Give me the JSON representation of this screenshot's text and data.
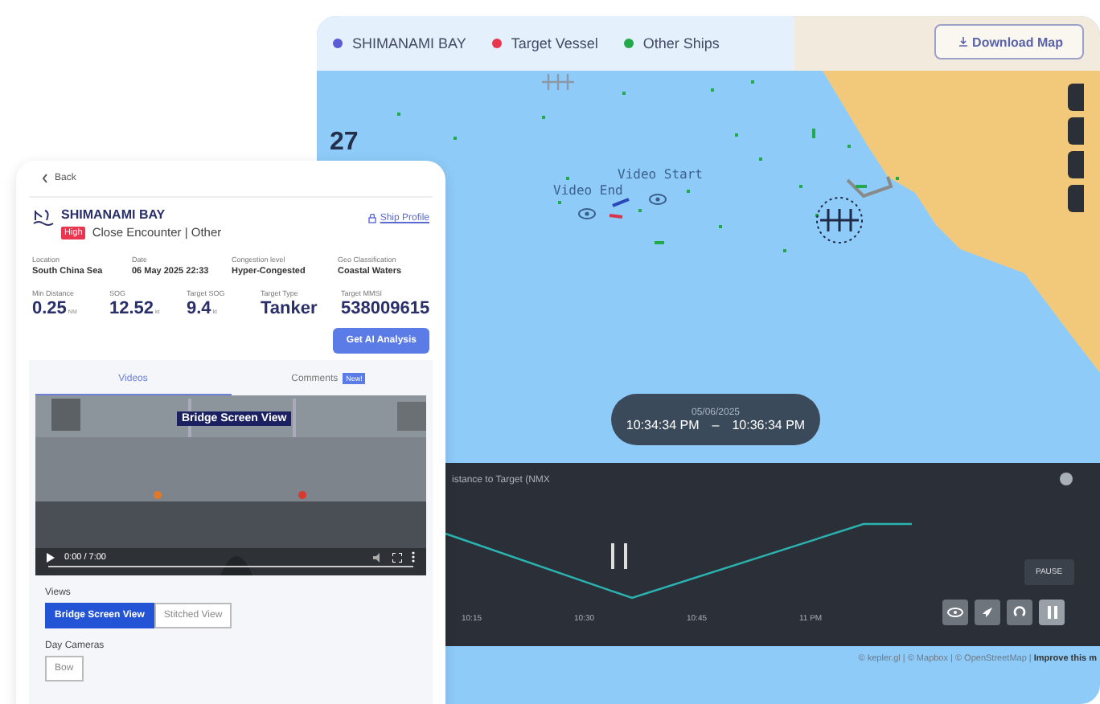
{
  "map": {
    "legend": [
      {
        "label": "SHIMANAMI BAY",
        "color": "#5b5bd6"
      },
      {
        "label": "Target Vessel",
        "color": "#e8364f"
      },
      {
        "label": "Other Ships",
        "color": "#22a94b"
      }
    ],
    "download_button": "Download Map",
    "grid_label": "27",
    "markers": [
      {
        "label": "Video Start"
      },
      {
        "label": "Video End"
      }
    ],
    "time_window": {
      "date": "05/06/2025",
      "start": "10:34:34 PM",
      "separator": "–",
      "end": "10:36:34 PM"
    },
    "timeline": {
      "title": "istance to Target (NMX",
      "xticks": [
        "10:15",
        "10:30",
        "10:45",
        "11 PM"
      ],
      "tooltip": "PAUSE",
      "controls": [
        {
          "kind": "eye",
          "selected": false
        },
        {
          "kind": "rocket",
          "selected": false
        },
        {
          "kind": "replay",
          "selected": false
        },
        {
          "kind": "pause",
          "selected": true
        }
      ]
    },
    "attribution": "© kepler.gl | © Mapbox | © OpenStreetMap | **Improve this m**"
  },
  "panel": {
    "back": "Back",
    "vessel": "SHIMANAMI BAY",
    "severity": "High",
    "event": "Close Encounter | Other",
    "profile_link": "Ship Profile",
    "info": [
      {
        "label": "Location",
        "value": "South China Sea"
      },
      {
        "label": "Date",
        "value": "06 May 2025 22:33"
      },
      {
        "label": "Congestion level",
        "value": "Hyper-Congested"
      },
      {
        "label": "Geo Classification",
        "value": "Coastal Waters"
      }
    ],
    "stats": [
      {
        "label": "Min Distance",
        "value": "0.25",
        "unit": "NM"
      },
      {
        "label": "SOG",
        "value": "12.52",
        "unit": "kt"
      },
      {
        "label": "Target SOG",
        "value": "9.4",
        "unit": "kt"
      },
      {
        "label": "Target Type",
        "value": "Tanker"
      },
      {
        "label": "Target MMSI",
        "value": "538009615"
      }
    ],
    "ai_button": "Get AI Analysis",
    "tabs": [
      {
        "label": "Videos",
        "selected": true
      },
      {
        "label": "Comments",
        "badge": "New!",
        "selected": false
      }
    ],
    "video": {
      "overlay_label": "Bridge Screen View",
      "time": "0:00 / 7:00"
    },
    "views_label": "Views",
    "views": [
      {
        "label": "Bridge Screen View",
        "selected": true
      },
      {
        "label": "Stitched View",
        "selected": false
      }
    ],
    "cameras_label": "Day Cameras",
    "cameras": [
      {
        "label": "Bow",
        "selected": false
      }
    ]
  }
}
